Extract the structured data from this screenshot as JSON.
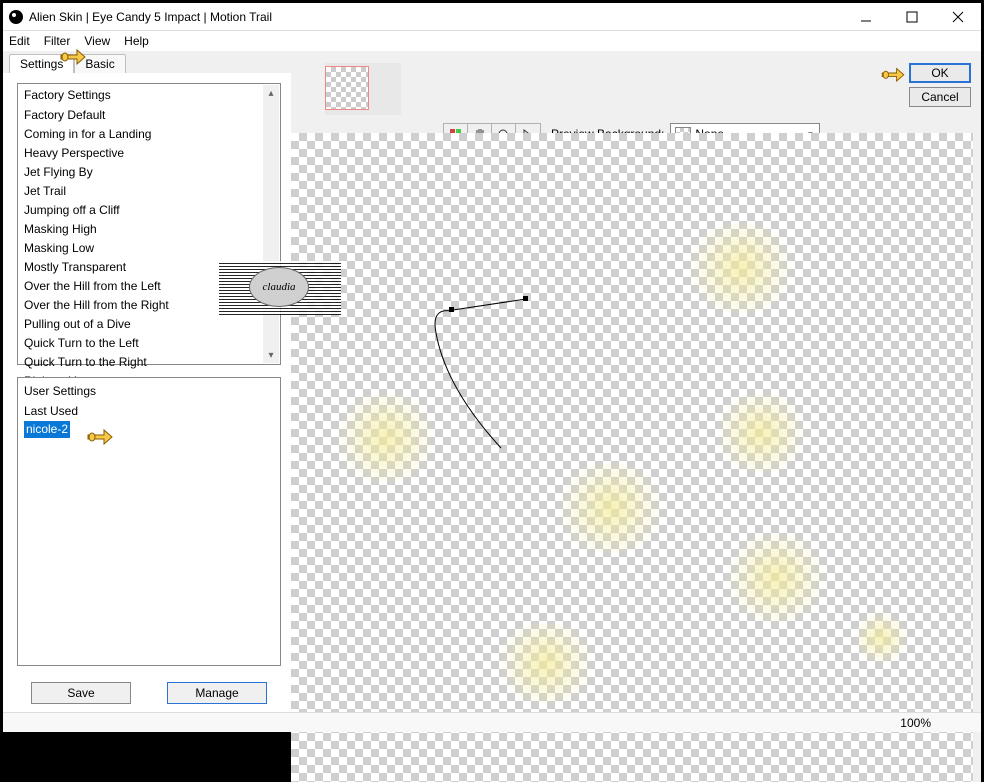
{
  "title": "Alien Skin | Eye Candy 5 Impact | Motion Trail",
  "menu": {
    "edit": "Edit",
    "filter": "Filter",
    "view": "View",
    "help": "Help"
  },
  "tabs": {
    "settings": "Settings",
    "basic": "Basic"
  },
  "factory": {
    "header": "Factory Settings",
    "items": [
      "Factory Default",
      "Coming in for a Landing",
      "Heavy Perspective",
      "Jet Flying By",
      "Jet Trail",
      "Jumping off a Cliff",
      "Masking High",
      "Masking Low",
      "Mostly Transparent",
      "Over the Hill from the Left",
      "Over the Hill from the Right",
      "Pulling out of a Dive",
      "Quick Turn to the Left",
      "Quick Turn to the Right",
      "Right at You"
    ]
  },
  "user": {
    "header": "User Settings",
    "items": [
      "Last Used",
      "nicole-2"
    ],
    "selected": "nicole-2"
  },
  "buttons": {
    "save": "Save",
    "manage": "Manage",
    "ok": "OK",
    "cancel": "Cancel"
  },
  "preview": {
    "label": "Preview Background:",
    "value": "None"
  },
  "status": {
    "zoom": "100%"
  },
  "watermark": "claudia"
}
